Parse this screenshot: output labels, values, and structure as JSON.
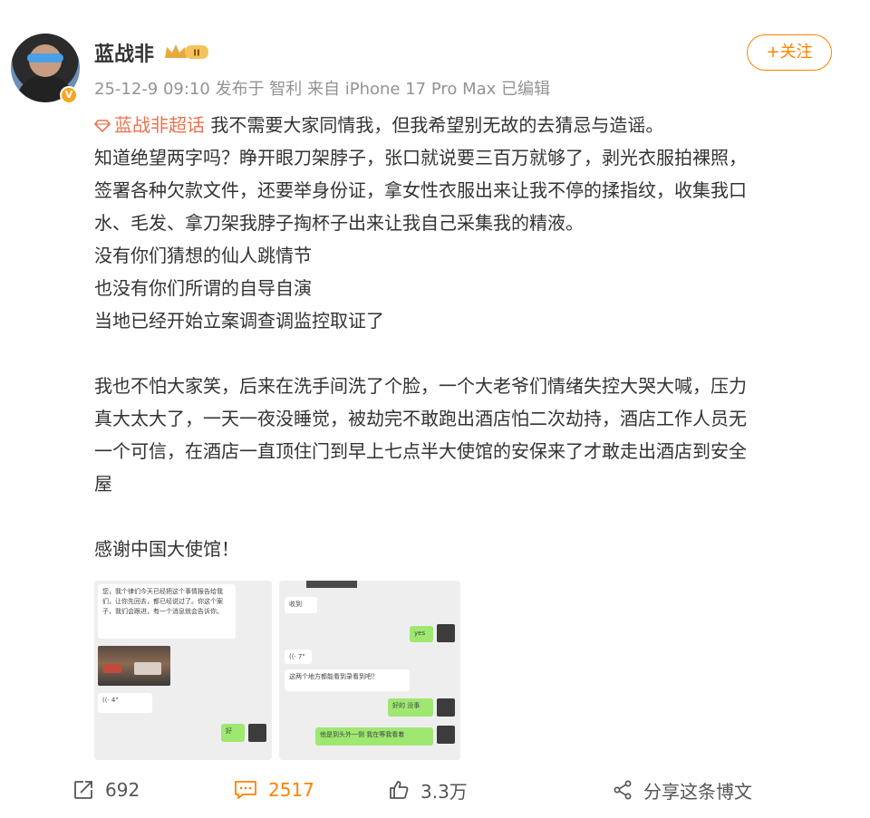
{
  "author": {
    "name": "蓝战非",
    "badge_text": "II",
    "verified_mark": "V"
  },
  "meta": "25-12-9 09:10 发布于 智利 来自 iPhone 17 Pro Max 已编辑",
  "follow_label": "+关注",
  "post": {
    "topic": "蓝战非超话",
    "line1_rest": " 我不需要大家同情我，但我希望别无故的去猜忌与造谣。",
    "line2": "知道绝望两字吗？睁开眼刀架脖子，张口就说要三百万就够了，剥光衣服拍裸照，",
    "line3": "签署各种欠款文件，还要举身份证，拿女性衣服出来让我不停的揉指纹，收集我口",
    "line4": "水、毛发、拿刀架我脖子掏杯子出来让我自己采集我的精液。",
    "line5": "没有你们猜想的仙人跳情节",
    "line6": "也没有你们所谓的自导自演",
    "line7": "当地已经开始立案调查调监控取证了",
    "line8": "我也不怕大家笑，后来在洗手间洗了个脸，一个大老爷们情绪失控大哭大喊，压力",
    "line9": "真大太大了，一天一夜没睡觉，被劫完不敢跑出酒店怕二次劫持，酒店工作人员无",
    "line10": "一个可信，在酒店一直顶住门到早上七点半大使馆的安保来了才敢走出酒店到安全",
    "line11": "屋",
    "line12": "感谢中国大使馆！"
  },
  "images": {
    "shot1_msg": "您，我个律们今天已经把这个事情报告给我们，让你先回去，都已经说过了。你这个案子，我们会跟进，有一个消息就会告诉你。",
    "shot1_voice": "((· 4\"",
    "shot1_reply": "好",
    "shot2_msg1": "收到",
    "shot2_green1": "yes",
    "shot2_voice": "((· 7\"",
    "shot2_msg2": "这两个地方都能看到录看到吧？",
    "shot2_green2": "好的 没事",
    "shot2_green3": "他是到头外一侧 我在等我看着",
    "colors": {
      "chat_bg": "#eeeeee",
      "bubble_green": "#9ee871"
    }
  },
  "actions": {
    "repost_icon": "repost-icon",
    "repost_count": "692",
    "comment_icon": "comment-icon",
    "comment_count": "2517",
    "like_icon": "thumbs-up-icon",
    "like_count": "3.3万",
    "share_icon": "share-icon",
    "share_label": "分享这条博文"
  },
  "colors": {
    "accent": "#ff8200",
    "topic": "#eb7350",
    "meta": "#939393",
    "text": "#333333"
  }
}
